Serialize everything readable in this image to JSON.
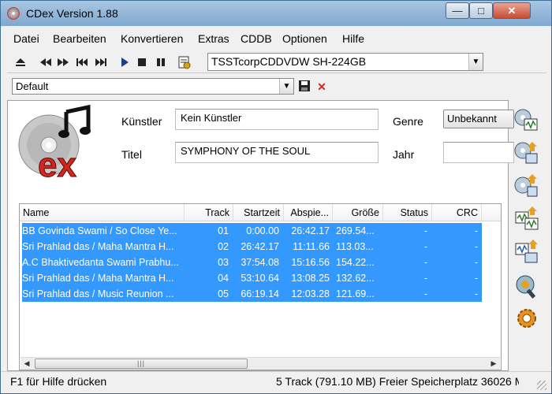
{
  "window": {
    "title": "CDex Version 1.88",
    "min_glyph": "—",
    "max_glyph": "□",
    "close_glyph": "✕"
  },
  "menu": [
    "Datei",
    "Bearbeiten",
    "Konvertieren",
    "Extras",
    "CDDB",
    "Optionen",
    "Hilfe"
  ],
  "toolbar": {
    "drive": "TSSTcorpCDDVDW SH-224GB"
  },
  "profile": {
    "value": "Default"
  },
  "album": {
    "artist_label": "Künstler",
    "artist_value": "Kein Künstler",
    "title_label": "Titel",
    "title_value": "SYMPHONY OF THE SOUL",
    "genre_label": "Genre",
    "genre_value": "Unbekannt",
    "year_label": "Jahr",
    "year_value": ""
  },
  "tracklist": {
    "columns": [
      "Name",
      "Track",
      "Startzeit",
      "Abspie...",
      "Größe",
      "Status",
      "CRC"
    ],
    "rows": [
      {
        "name": "BB Govinda Swami / So Close Ye...",
        "track": "01",
        "start": "0:00.00",
        "play": "26:42.17",
        "size": "269.54...",
        "status": "-",
        "crc": "-"
      },
      {
        "name": "Sri Prahlad das / Maha Mantra H...",
        "track": "02",
        "start": "26:42.17",
        "play": "11:11.66",
        "size": "113.03...",
        "status": "-",
        "crc": "-"
      },
      {
        "name": "A.C Bhaktivedanta Swami Prabhu...",
        "track": "03",
        "start": "37:54.08",
        "play": "15:16.56",
        "size": "154.22...",
        "status": "-",
        "crc": "-"
      },
      {
        "name": "Sri Prahlad das / Maha Mantra H...",
        "track": "04",
        "start": "53:10.64",
        "play": "13:08.25",
        "size": "132.62...",
        "status": "-",
        "crc": "-"
      },
      {
        "name": "Sri Prahlad das / Music Reunion ...",
        "track": "05",
        "start": "66:19.14",
        "play": "12:03.28",
        "size": "121.69...",
        "status": "-",
        "crc": "-"
      }
    ]
  },
  "status": {
    "left": "F1 für Hilfe drücken",
    "right": "5 Track (791.10 MB) Freier Speicherplatz 36026 M"
  },
  "colors": {
    "selection": "#3399ff",
    "accent_red": "#d0281f"
  }
}
